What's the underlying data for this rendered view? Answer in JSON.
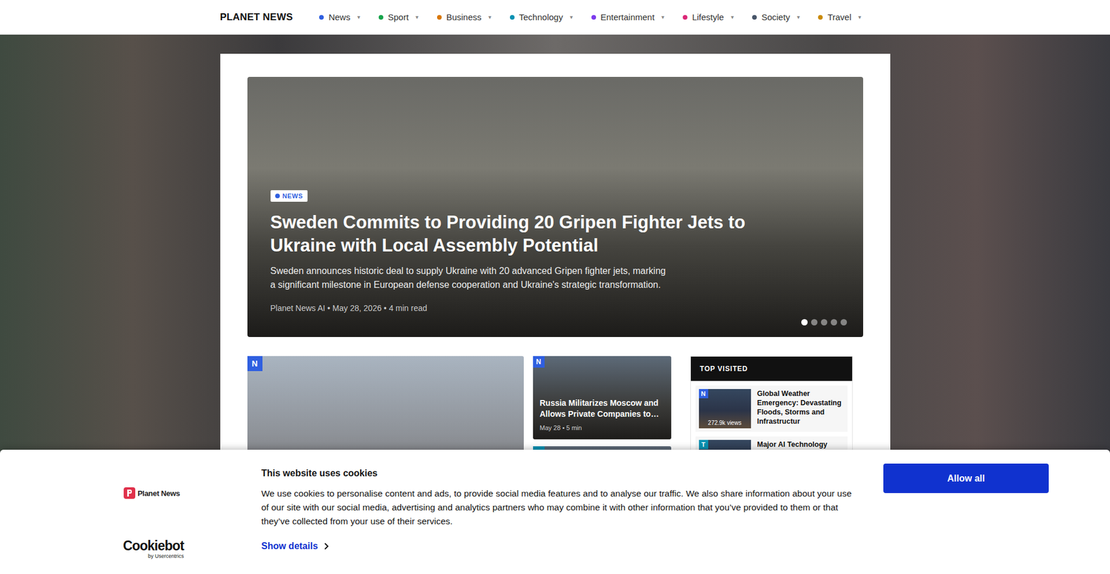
{
  "brand": "PLANET NEWS",
  "nav": [
    {
      "label": "News",
      "caret": "▾",
      "color": "#2f5fe0"
    },
    {
      "label": "Sport",
      "caret": "▾",
      "color": "#16a34a"
    },
    {
      "label": "Business",
      "caret": "▾",
      "color": "#d97706"
    },
    {
      "label": "Technology",
      "caret": "▾",
      "color": "#0891b2"
    },
    {
      "label": "Entertainment",
      "caret": "▾",
      "color": "#7c3aed"
    },
    {
      "label": "Lifestyle",
      "caret": "▾",
      "color": "#db2777"
    },
    {
      "label": "Society",
      "caret": "▾",
      "color": "#475569"
    },
    {
      "label": "Travel",
      "caret": "▾",
      "color": "#ca8a04"
    }
  ],
  "hero": {
    "category": "NEWS",
    "category_color": "#2f5fe0",
    "title": "Sweden Commits to Providing 20 Gripen Fighter Jets to Ukraine with Local Assembly Potential",
    "description": "Sweden announces historic deal to supply Ukraine with 20 advanced Gripen fighter jets, marking a significant milestone in European defense cooperation and Ukraine's strategic transformation.",
    "meta": "Planet News AI • May 28, 2026 • 4 min read",
    "slides": [
      {
        "selected": true
      },
      {
        "selected": false
      },
      {
        "selected": false
      },
      {
        "selected": false
      },
      {
        "selected": false
      }
    ]
  },
  "feature": {
    "badge": "N",
    "color": "#2f5fe0"
  },
  "side_cards": [
    {
      "badge": "N",
      "color": "#2f5fe0",
      "title": "Russia Militarizes Moscow and Allows Private Companies to…",
      "meta": "May 28 • 5 min"
    },
    {
      "badge": "",
      "color": "#0891b2",
      "title": "",
      "meta": ""
    }
  ],
  "top_visited": {
    "heading": "TOP VISITED",
    "items": [
      {
        "badge": "N",
        "color": "#2f5fe0",
        "title": "Global Weather Emergency: Devastating Floods, Storms and Infrastructur",
        "views": "272.9k views"
      },
      {
        "badge": "T",
        "color": "#0891b2",
        "title": "Major AI Technology",
        "views": ""
      }
    ]
  },
  "cookie": {
    "logo": "Planet News",
    "title": "This website uses cookies",
    "body": "We use cookies to personalise content and ads, to provide social media features and to analyse our traffic. We also share information about your use of our site with our social media, advertising and analytics partners who may combine it with other information that you’ve provided to them or that they’ve collected from your use of their services.",
    "details": "Show details",
    "allow": "Allow all",
    "cookiebot": "Cookiebot",
    "by": "by Usercentrics"
  }
}
